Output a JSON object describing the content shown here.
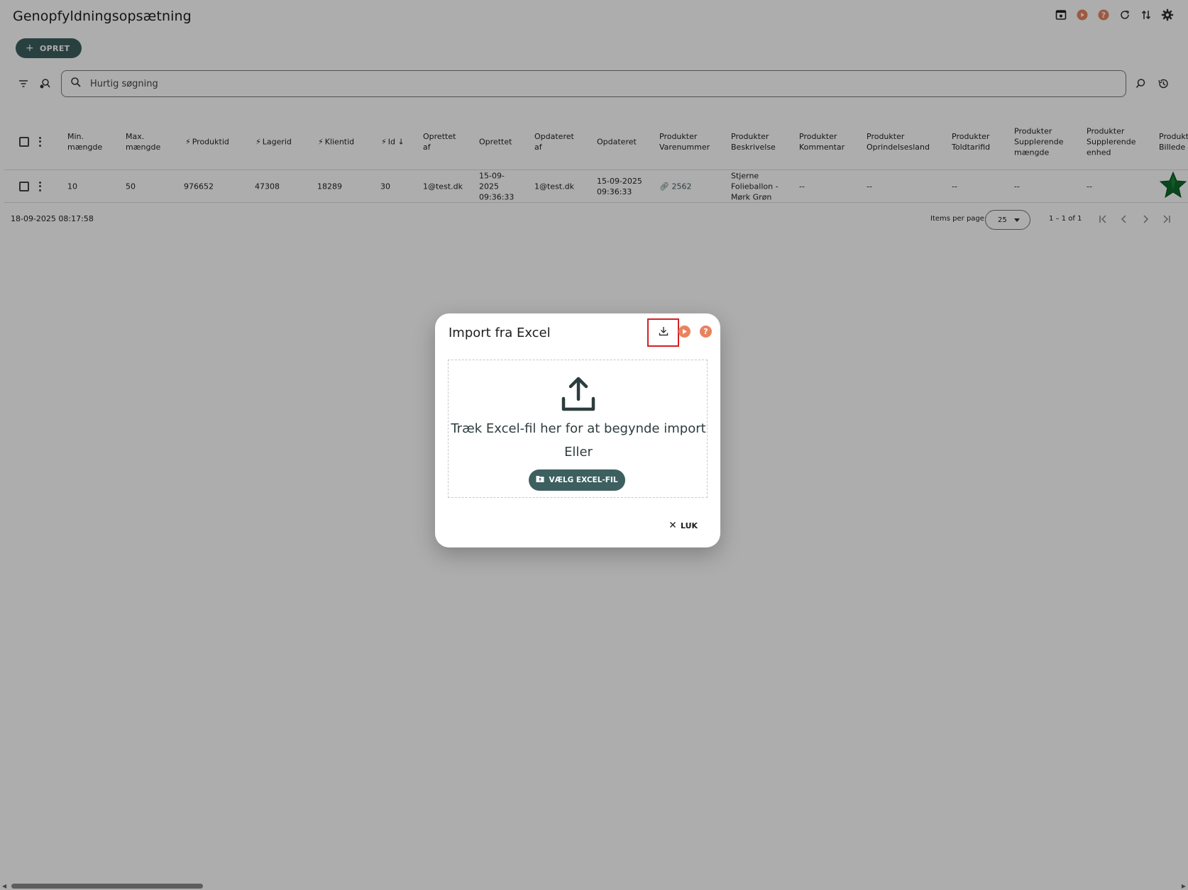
{
  "header": {
    "title": "Genopfyldningsopsætning",
    "create_label": "OPRET",
    "actions": [
      "preview-icon",
      "play-icon",
      "help-icon",
      "refresh-icon",
      "sort-icon",
      "gear-icon"
    ]
  },
  "search": {
    "placeholder": "Hurtig søgning"
  },
  "table": {
    "columns": [
      {
        "label": "Min. mængde",
        "lines": [
          "Min.",
          "mængde"
        ]
      },
      {
        "label": "Max. mængde",
        "lines": [
          "Max.",
          "mængde"
        ]
      },
      {
        "label": "Produktid",
        "bolt": true
      },
      {
        "label": "Lagerid",
        "bolt": true
      },
      {
        "label": "Klientid",
        "bolt": true
      },
      {
        "label": "Id",
        "bolt": true,
        "sorted": "desc"
      },
      {
        "label": "Oprettet af",
        "lines": [
          "Oprettet",
          "af"
        ]
      },
      {
        "label": "Oprettet"
      },
      {
        "label": "Opdateret af",
        "lines": [
          "Opdateret",
          "af"
        ]
      },
      {
        "label": "Opdateret"
      },
      {
        "label": "Produkter Varenummer",
        "lines": [
          "Produkter",
          "Varenummer"
        ]
      },
      {
        "label": "Produkter Beskrivelse",
        "lines": [
          "Produkter",
          "Beskrivelse"
        ]
      },
      {
        "label": "Produkter Kommentar",
        "lines": [
          "Produkter",
          "Kommentar"
        ]
      },
      {
        "label": "Produkter Oprindelsesland",
        "lines": [
          "Produkter",
          "Oprindelsesland"
        ]
      },
      {
        "label": "Produkter Toldtarifid",
        "lines": [
          "Produkter",
          "Toldtarifid"
        ]
      },
      {
        "label": "Produkter Supplerende mængde",
        "lines": [
          "Produkter",
          "Supplerende",
          "mængde"
        ]
      },
      {
        "label": "Produkter Supplerende enhed",
        "lines": [
          "Produkter",
          "Supplerende",
          "enhed"
        ]
      },
      {
        "label": "Produkter Billede",
        "lines": [
          "Produkt",
          "Billede"
        ]
      }
    ],
    "rows": [
      {
        "min": "10",
        "max": "50",
        "produktid": "976652",
        "lagerid": "47308",
        "klientid": "18289",
        "id": "30",
        "oprettet_af": "1@test.dk",
        "oprettet_lines": [
          "15-09-",
          "2025",
          "09:36:33"
        ],
        "opdateret_af": "1@test.dk",
        "opdateret_lines": [
          "15-09-2025",
          "09:36:33"
        ],
        "varenummer": "2562",
        "beskrivelse_lines": [
          "Stjerne",
          "Folieballon -",
          "Mørk Grøn"
        ],
        "kommentar": "--",
        "oprindelsesland": "--",
        "toldtarifid": "--",
        "suppl_maengde": "--",
        "suppl_enhed": "--",
        "image": "green-star-balloon"
      }
    ]
  },
  "footer": {
    "timestamp": "18-09-2025 08:17:58",
    "items_per_page_label": "Items per page:",
    "items_per_page_value": "25",
    "range": "1 – 1 of 1"
  },
  "dialog": {
    "title": "Import fra Excel",
    "drop_text": "Træk Excel-fil her for at begynde import",
    "or_text": "Eller",
    "choose_label": "VÆLG EXCEL-FIL",
    "close_label": "LUK",
    "accent_color": "#e8835f",
    "highlight_color": "#d32121"
  },
  "colors": {
    "primary": "#3d5f5f",
    "overlay": "rgba(0,0,0,0.32)"
  }
}
